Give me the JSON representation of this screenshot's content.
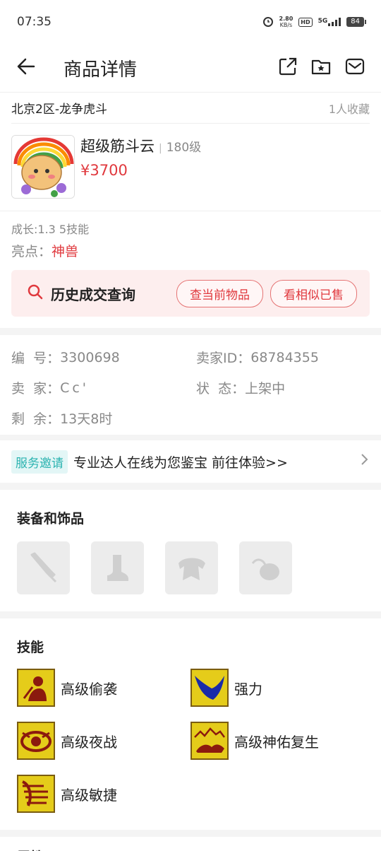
{
  "status": {
    "time": "07:35",
    "speed_top": "2.80",
    "speed_bottom": "KB/s",
    "hd": "HD",
    "net": "5G",
    "battery": "84"
  },
  "nav": {
    "title": "商品详情"
  },
  "server": {
    "name": "北京2区-龙争虎斗",
    "favorites": "1人收藏"
  },
  "item": {
    "name": "超级筋斗云",
    "level": "180级",
    "price": "¥3700"
  },
  "growth": "成长:1.3 5技能",
  "highlight": {
    "label": "亮点：",
    "value": "神兽"
  },
  "history": {
    "label": "历史成交查询",
    "btn_current": "查当前物品",
    "btn_similar": "看相似已售"
  },
  "info": {
    "serial_label": "编  号：",
    "serial": "3300698",
    "seller_id_label": "卖家ID：",
    "seller_id": "68784355",
    "seller_label": "卖  家：",
    "seller": "Cc'",
    "state_label": "状  态：",
    "state": "上架中",
    "remain_label": "剩  余：",
    "remain": "13天8时"
  },
  "service": {
    "tag": "服务邀请",
    "text": "专业达人在线为您鉴宝 前往体验>>"
  },
  "equipment": {
    "title": "装备和饰品",
    "slots": [
      "weapon",
      "boots",
      "armor",
      "accessory"
    ]
  },
  "skills": {
    "title": "技能",
    "items": [
      {
        "name": "高级偷袭"
      },
      {
        "name": "强力"
      },
      {
        "name": "高级夜战"
      },
      {
        "name": "高级神佑复生"
      },
      {
        "name": "高级敏捷"
      }
    ]
  },
  "attributes": {
    "title": "属性"
  },
  "colors": {
    "accent": "#e0393e",
    "teal": "#2bb3b0"
  }
}
